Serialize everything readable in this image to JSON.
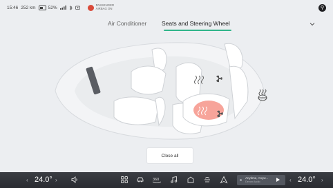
{
  "status": {
    "time": "15:46",
    "range": "252 km",
    "battery": "52%",
    "airbag_line1": "PASSENGER",
    "airbag_line2": "AIRBAG ON"
  },
  "tabs": [
    {
      "label": "Air Conditioner",
      "active": false
    },
    {
      "label": "Seats and Steering Wheel",
      "active": true
    }
  ],
  "main": {
    "close_all_label": "Close all"
  },
  "bottom": {
    "temp_left": "24.0°",
    "temp_right": "24.0°",
    "media_title": "Anytime, Anyw...",
    "media_sub": "Devon Audio"
  },
  "colors": {
    "accent": "#2fb58a",
    "heat": "#f15a47",
    "bar": "#2d3035"
  },
  "icons": [
    "signal-icon",
    "bluetooth-icon",
    "battery-icon",
    "airbag-icon",
    "profile-icon",
    "chevron-down-icon",
    "volume-icon",
    "apps-grid-icon",
    "car-icon",
    "360-view-icon",
    "music-icon",
    "home-icon",
    "fan-icon",
    "navigation-icon",
    "play-icon",
    "steering-heat-icon",
    "seat-heat-icon",
    "seat-ventilation-icon"
  ]
}
